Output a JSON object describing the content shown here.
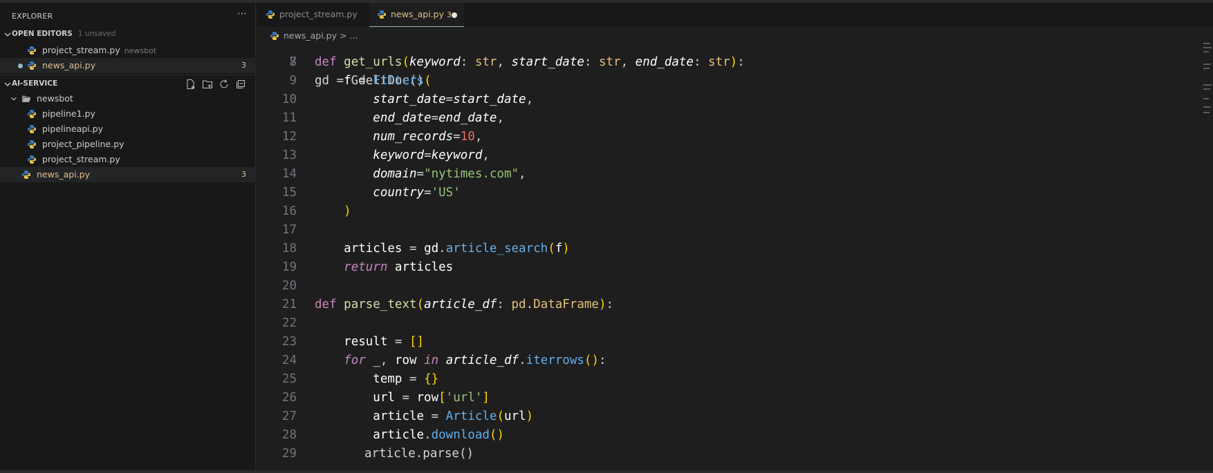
{
  "explorer": {
    "title": "EXPLORER"
  },
  "open_editors": {
    "header": "OPEN EDITORS",
    "note": "1 unsaved",
    "items": [
      {
        "name": "project_stream.py",
        "hint": "newsbot",
        "count": ""
      },
      {
        "name": "news_api.py",
        "hint": "",
        "count": "3"
      }
    ]
  },
  "workspace": {
    "header": "AI-SERVICE",
    "folder": "newsbot",
    "files": [
      "pipeline1.py",
      "pipelineapi.py",
      "project_pipeline.py",
      "project_stream.py"
    ],
    "root_file": {
      "name": "news_api.py",
      "count": "3"
    }
  },
  "tabs": [
    {
      "label": "project_stream.py",
      "badge": ""
    },
    {
      "label": "news_api.py",
      "badge": "3"
    }
  ],
  "breadcrumb": {
    "file": "news_api.py",
    "rest": "> ..."
  },
  "editor": {
    "partial_top": "gd = GdeltDoc()",
    "partial_bottom": "article.parse()",
    "line_numbers": [
      "7",
      "8",
      "9",
      "10",
      "11",
      "12",
      "13",
      "14",
      "15",
      "16",
      "17",
      "18",
      "19",
      "20",
      "21",
      "22",
      "23",
      "24",
      "25",
      "26",
      "27",
      "28",
      "29"
    ]
  },
  "colors": {
    "accent_modified": "#e2c08d",
    "tab_active_underline": "#9ab7c4",
    "background": "#1e1e1e",
    "sidebar": "#181818"
  }
}
